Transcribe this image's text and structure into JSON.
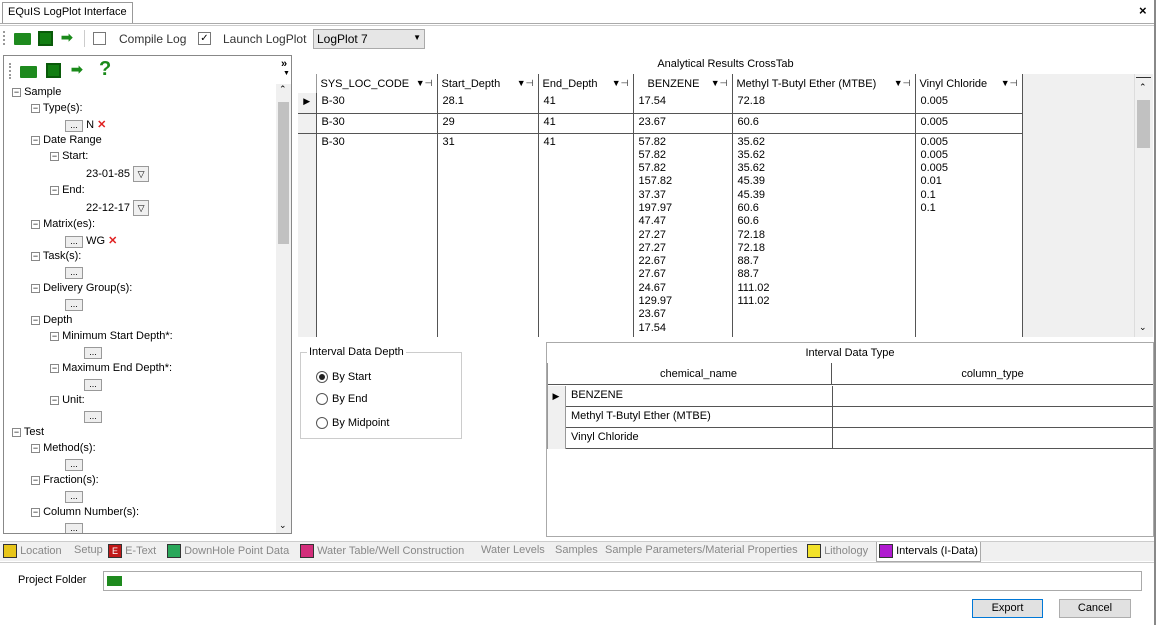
{
  "window": {
    "title": "EQuIS LogPlot Interface",
    "close": "×"
  },
  "toolbar": {
    "compile_log": "Compile Log",
    "compile_checked": false,
    "launch_logplot": "Launch LogPlot",
    "launch_checked": true,
    "version": "LogPlot 7",
    "version_arrow": "▼"
  },
  "left_toolbar": {
    "help": "?",
    "chevron": "»"
  },
  "tree": {
    "sample": "Sample",
    "types": "Type(s):",
    "types_value": "N",
    "date_range": "Date Range",
    "start": "Start:",
    "start_value": "23-01-85",
    "end": "End:",
    "end_value": "22-12-17",
    "matrix": "Matrix(es):",
    "matrix_value": "WG",
    "tasks": "Task(s):",
    "delivery": "Delivery Group(s):",
    "depth": "Depth",
    "min_start": "Minimum Start Depth*:",
    "max_end": "Maximum End Depth*:",
    "unit": "Unit:",
    "test": "Test",
    "methods": "Method(s):",
    "fractions": "Fraction(s):",
    "column_numbers": "Column Number(s):",
    "dots": "...",
    "remove": "✕"
  },
  "crosstab": {
    "title": "Analytical Results CrossTab",
    "headers": [
      "SYS_LOC_CODE",
      "Start_Depth",
      "End_Depth",
      "BENZENE",
      "Methyl T-Butyl Ether (MTBE)",
      "Vinyl Chloride"
    ],
    "rows": [
      [
        "B-30",
        "28.1",
        "41",
        "17.54",
        "72.18",
        "0.005"
      ],
      [
        "B-30",
        "29",
        "41",
        "23.67",
        "60.6",
        "0.005"
      ],
      [
        "B-30",
        "31",
        "41",
        "57.82\n57.82\n57.82\n157.82\n37.37\n197.97\n47.47\n27.27\n27.27\n22.67\n27.67\n24.67\n129.97\n23.67\n17.54",
        "35.62\n35.62\n35.62\n45.39\n45.39\n60.6\n60.6\n72.18\n72.18\n88.7\n88.7\n111.02\n111.02",
        "0.005\n0.005\n0.005\n0.01\n0.1\n0.1"
      ]
    ],
    "filter_icon": "▼⊣"
  },
  "interval_depth": {
    "title": "Interval Data Depth",
    "options": [
      "By Start",
      "By End",
      "By Midpoint"
    ],
    "selected": "By Start"
  },
  "interval_type": {
    "title": "Interval Data Type",
    "headers": [
      "chemical_name",
      "column_type"
    ],
    "rows": [
      [
        "BENZENE",
        ""
      ],
      [
        "Methyl T-Butyl Ether (MTBE)",
        ""
      ],
      [
        "Vinyl Chloride",
        ""
      ]
    ]
  },
  "bottom_tabs": [
    "Location",
    "Setup",
    "E-Text",
    "DownHole Point Data",
    "Water Table/Well Construction",
    "Water Levels",
    "Samples",
    "Sample Parameters/Material Properties",
    "Lithology",
    "Intervals (I-Data)"
  ],
  "active_tab": "Intervals (I-Data)",
  "footer": {
    "project_folder": "Project Folder",
    "folder_value": "",
    "export": "Export",
    "cancel": "Cancel"
  }
}
